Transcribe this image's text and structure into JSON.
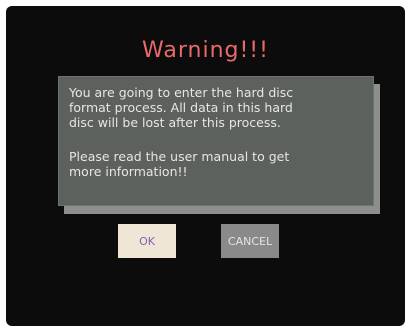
{
  "dialog": {
    "title": "Warning!!!",
    "message_1": "You are going to enter the hard disc\nformat process. All data in this hard\ndisc will be lost after this process.",
    "message_2": "Please read the user manual to get\nmore information!!",
    "ok_label": "OK",
    "cancel_label": "CANCEL"
  },
  "colors": {
    "background": "#0c0c0c",
    "title": "#e86a6a",
    "panel": "#5c615d",
    "ok_button": "#efe6d6",
    "cancel_button": "#8a8a8a"
  }
}
